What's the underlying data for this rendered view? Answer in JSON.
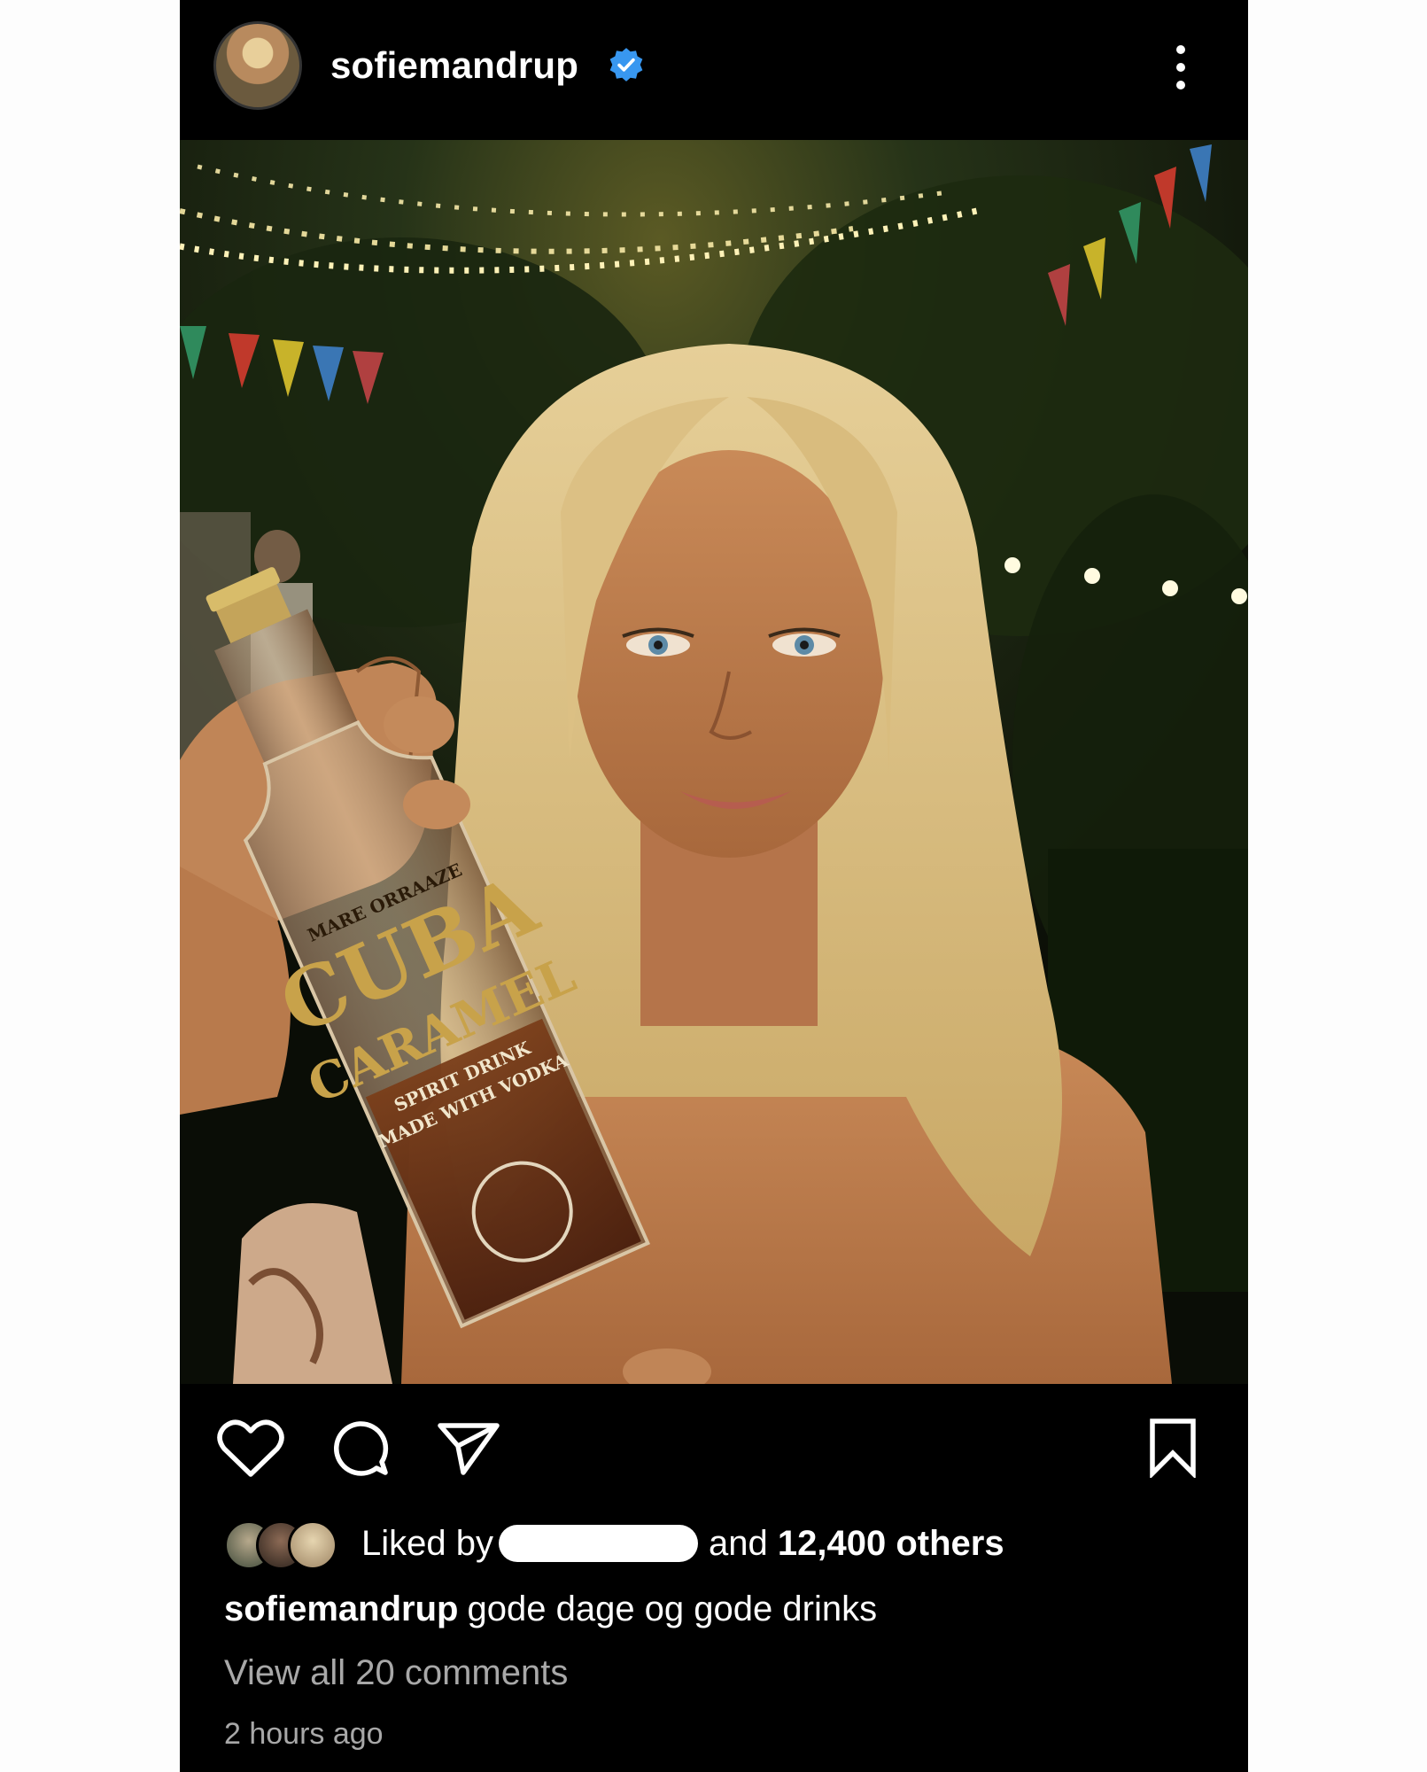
{
  "post": {
    "username": "sofiemandrup",
    "verified": true,
    "accent_color": "#3897f0",
    "more_icon": "more-vertical-icon"
  },
  "photo": {
    "bottle_label_lines": [
      "MARE",
      "ORRAAZE",
      "CUBA",
      "CARAMEL",
      "SPIRIT DRINK",
      "MADE WITH VODKA"
    ]
  },
  "actions": {
    "like_icon": "heart-icon",
    "comment_icon": "comment-icon",
    "share_icon": "send-icon",
    "save_icon": "bookmark-icon"
  },
  "likes": {
    "prefix": "Liked by",
    "middle": "and",
    "count": "12,400 others"
  },
  "caption": {
    "username": "sofiemandrup",
    "text": "gode dage og gode drinks"
  },
  "view_comments": "View all 20 comments",
  "timestamp": "2 hours ago"
}
